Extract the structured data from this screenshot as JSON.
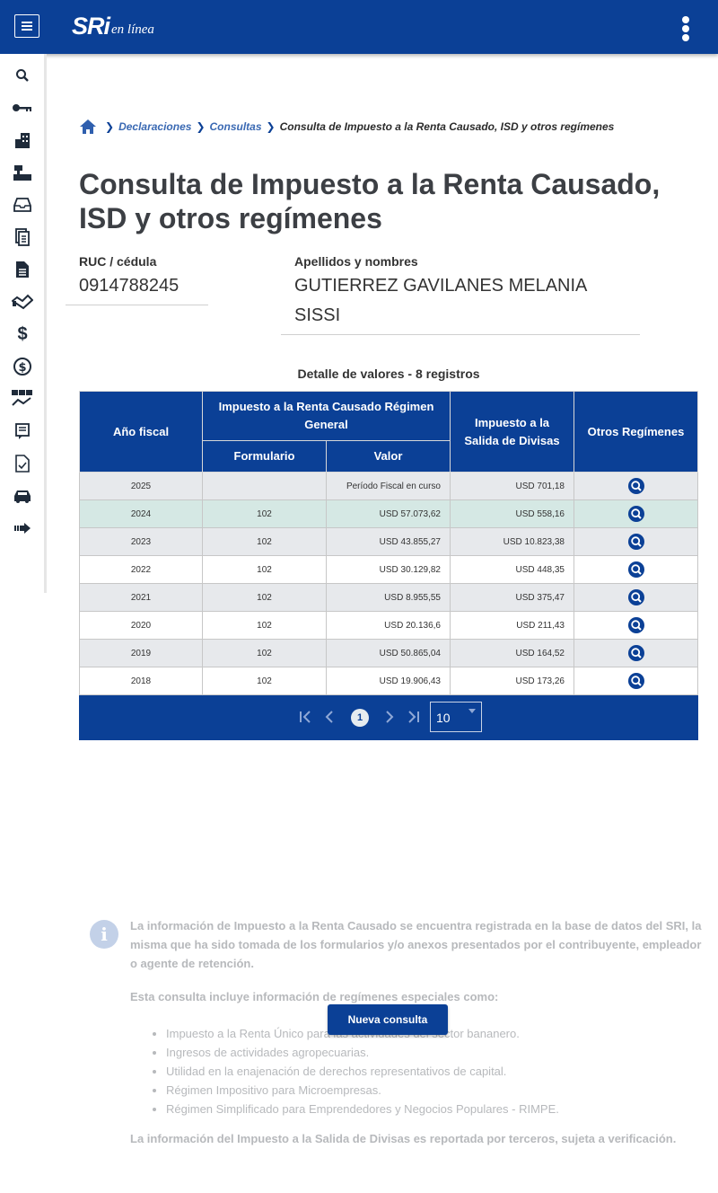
{
  "header": {
    "logo_main": "SRi",
    "logo_sub": "en línea"
  },
  "sidebar": {
    "icons": [
      "search-icon",
      "key-icon",
      "building-icon",
      "cash-register-icon",
      "inbox-icon",
      "documents-icon",
      "file-icon",
      "handshake-icon",
      "dollar-icon",
      "coin-icon",
      "exchange-icon",
      "forms-icon",
      "checklist-icon",
      "car-icon",
      "arrow-right-icon"
    ]
  },
  "breadcrumb": {
    "items": [
      "Declaraciones",
      "Consultas"
    ],
    "current": "Consulta de Impuesto a la Renta Causado, ISD y otros regímenes"
  },
  "page_title": "Consulta de Impuesto a la Renta Causado, ISD y otros regímenes",
  "fields": {
    "ruc_label": "RUC / cédula",
    "ruc_value": "0914788245",
    "name_label": "Apellidos y nombres",
    "name_value": "GUTIERREZ GAVILANES MELANIA SISSI"
  },
  "table": {
    "caption": "Detalle de valores - 8 registros",
    "headers": {
      "year": "Año fiscal",
      "general": "Impuesto a la Renta Causado Régimen General",
      "form": "Formulario",
      "value": "Valor",
      "isd": "Impuesto a la Salida de Divisas",
      "other": "Otros Regímenes"
    },
    "rows": [
      {
        "year": "2025",
        "form": "",
        "value": "Período Fiscal en curso",
        "isd": "USD 701,18"
      },
      {
        "year": "2024",
        "form": "102",
        "value": "USD 57.073,62",
        "isd": "USD 558,16"
      },
      {
        "year": "2023",
        "form": "102",
        "value": "USD 43.855,27",
        "isd": "USD 10.823,38"
      },
      {
        "year": "2022",
        "form": "102",
        "value": "USD 30.129,82",
        "isd": "USD 448,35"
      },
      {
        "year": "2021",
        "form": "102",
        "value": "USD 8.955,55",
        "isd": "USD 375,47"
      },
      {
        "year": "2020",
        "form": "102",
        "value": "USD 20.136,6",
        "isd": "USD 211,43"
      },
      {
        "year": "2019",
        "form": "102",
        "value": "USD 50.865,04",
        "isd": "USD 164,52"
      },
      {
        "year": "2018",
        "form": "102",
        "value": "USD 19.906,43",
        "isd": "USD 173,26"
      }
    ]
  },
  "pager": {
    "current_page": "1",
    "page_size": "10"
  },
  "info": {
    "p1": "La información de Impuesto a la Renta Causado se encuentra registrada en la base de datos del SRI, la misma que ha sido tomada de los formularios y/o anexos presentados por el contribuyente, empleador o agente de retención.",
    "p2": "Esta consulta incluye información de regímenes especiales como:",
    "list": [
      "Impuesto a la Renta Único para las actividades del sector bananero.",
      "Ingresos de actividades agropecuarias.",
      "Utilidad en la enajenación de derechos representativos de capital.",
      "Régimen Impositivo para Microempresas.",
      "Régimen Simplificado para Emprendedores y Negocios Populares - RIMPE."
    ],
    "p3": "La información del Impuesto a la Salida de Divisas es reportada por terceros, sujeta a verificación."
  },
  "buttons": {
    "new_query": "Nueva consulta"
  },
  "colors": {
    "primary": "#0b4096",
    "row_gray": "#e7e9ec",
    "row_highlight": "#d5e8e4"
  }
}
